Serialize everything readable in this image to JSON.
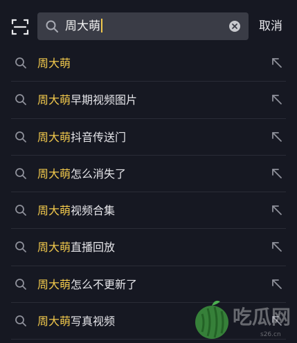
{
  "search": {
    "value": "周大萌",
    "cancel_label": "取消"
  },
  "suggestions": [
    {
      "highlight": "周大萌",
      "rest": ""
    },
    {
      "highlight": "周大萌",
      "rest": "早期视频图片"
    },
    {
      "highlight": "周大萌",
      "rest": "抖音传送门"
    },
    {
      "highlight": "周大萌",
      "rest": "怎么消失了"
    },
    {
      "highlight": "周大萌",
      "rest": "视频合集"
    },
    {
      "highlight": "周大萌",
      "rest": "直播回放"
    },
    {
      "highlight": "周大萌",
      "rest": "怎么不更新了"
    },
    {
      "highlight": "周大萌",
      "rest": "写真视频"
    }
  ],
  "watermark": {
    "text": "吃瓜网",
    "url": "s26.cn"
  },
  "colors": {
    "background": "#161822",
    "search_box": "#3a3c46",
    "highlight": "#f2c94c",
    "divider": "#2a2c37"
  },
  "icons": {
    "scan": "scan-icon",
    "search": "search-icon",
    "clear": "clear-icon",
    "fill": "arrow-up-left-icon"
  }
}
